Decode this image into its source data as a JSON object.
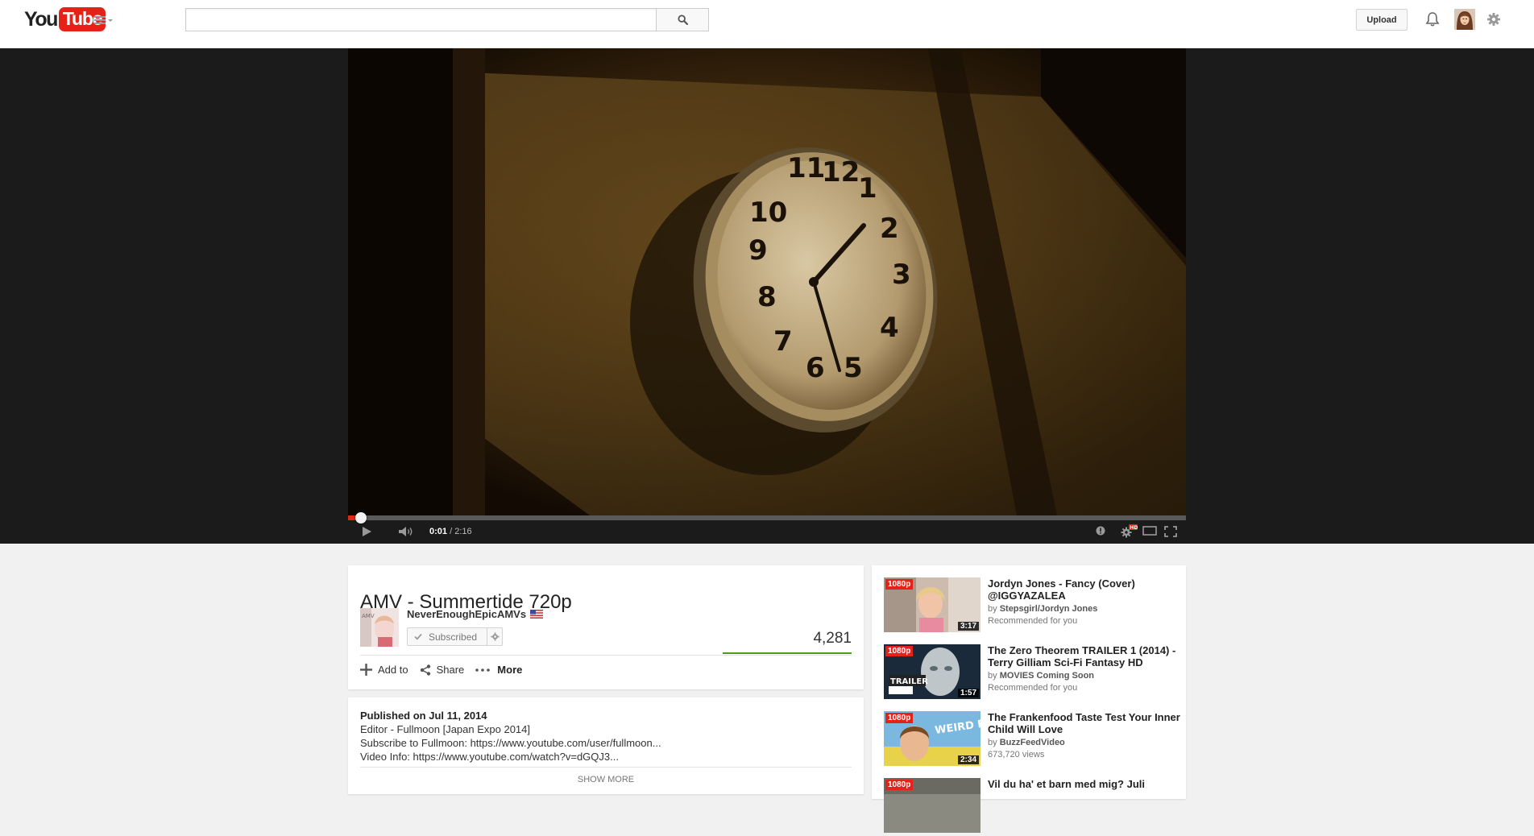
{
  "masthead": {
    "logo_you": "You",
    "logo_tube": "Tube",
    "search_placeholder": "",
    "search_value": "",
    "upload_label": "Upload"
  },
  "player": {
    "current_time": "0:01",
    "duration": "/ 2:16",
    "progress_fraction": 0.007,
    "hd_badge": "HD"
  },
  "video": {
    "title": "AMV - Summertide 720p",
    "channel": "NeverEnoughEpicAMVs",
    "subscribe_label": "Subscribed",
    "views": "4,281",
    "actions": {
      "add_to": "Add to",
      "share": "Share",
      "more": "More"
    }
  },
  "description": {
    "published": "Published on Jul 11, 2014",
    "lines": [
      "Editor - Fullmoon [Japan Expo 2014]",
      "Subscribe to Fullmoon: https://www.youtube.com/user/fullmoon...",
      "Video Info: https://www.youtube.com/watch?v=dGQJ3..."
    ],
    "show_more": "SHOW MORE"
  },
  "recommendations": [
    {
      "badge": "1080p",
      "duration": "3:17",
      "title": "Jordyn Jones - Fancy (Cover) @IGGYAZALEA",
      "by": "by ",
      "channel": "Stepsgirl/Jordyn Jones",
      "meta": "Recommended for you"
    },
    {
      "badge": "1080p",
      "duration": "1:57",
      "title": "The Zero Theorem TRAILER 1 (2014) - Terry Gilliam Sci-Fi Fantasy HD",
      "by": "by ",
      "channel": "MOVIES Coming Soon",
      "meta": "Recommended for you",
      "thumb_text": "TRAILER"
    },
    {
      "badge": "1080p",
      "duration": "2:34",
      "title": "The Frankenfood Taste Test Your Inner Child Will Love",
      "by": "by ",
      "channel": "BuzzFeedVideo",
      "meta": "673,720 views",
      "thumb_text": "WEIRD FOODS!"
    },
    {
      "badge": "1080p",
      "title": "Vil du ha' et barn med mig? Juli"
    }
  ],
  "colors": {
    "brand_red": "#e62117",
    "progress_red": "#e1251b",
    "view_bar_green": "#4f9a1b"
  },
  "icons": {
    "menu": "guide-menu-icon",
    "search": "search-icon",
    "bell": "bell-icon",
    "settings": "gear-icon",
    "play": "play-icon",
    "volume": "volume-icon",
    "annotations": "annotations-icon",
    "theater": "theater-mode-icon",
    "fullscreen": "fullscreen-icon"
  }
}
